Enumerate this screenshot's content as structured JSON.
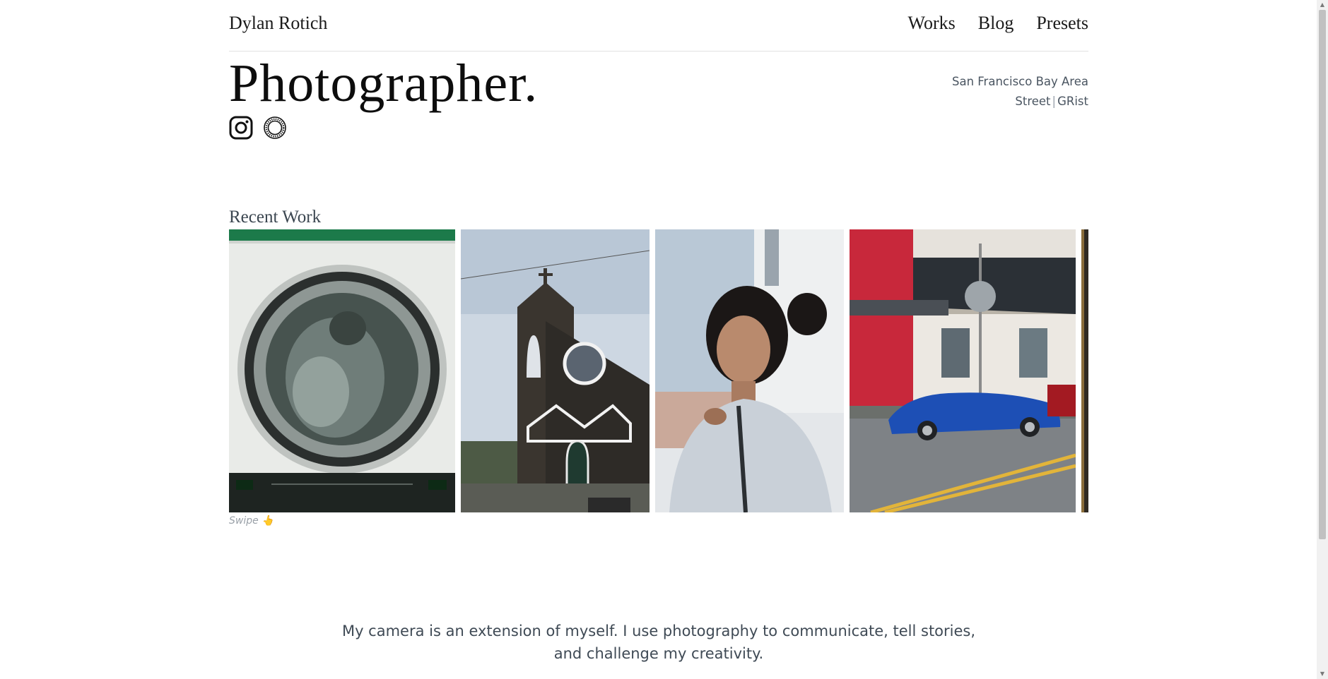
{
  "header": {
    "brand": "Dylan Rotich",
    "nav": [
      {
        "label": "Works"
      },
      {
        "label": "Blog"
      },
      {
        "label": "Presets"
      }
    ]
  },
  "hero": {
    "title": "Photographer.",
    "location": "San Francisco Bay Area",
    "links": [
      "Street",
      "GRist"
    ],
    "separator": "|",
    "socials": [
      {
        "icon": "instagram-icon"
      },
      {
        "icon": "vsco-icon"
      }
    ]
  },
  "recent_work": {
    "title": "Recent Work",
    "swipe_hint": "Swipe 👆",
    "photos": [
      {
        "subject": "laundromat-dryer"
      },
      {
        "subject": "church"
      },
      {
        "subject": "portrait"
      },
      {
        "subject": "blue-sports-car"
      },
      {
        "subject": "partial"
      }
    ]
  },
  "intro": {
    "line1": "My camera is an extension of myself. I use photography to communicate, tell stories,",
    "line2": "and challenge my creativity."
  },
  "colors": {
    "text": "#111111",
    "muted": "#4a5561",
    "divider": "#e2e2e2"
  }
}
